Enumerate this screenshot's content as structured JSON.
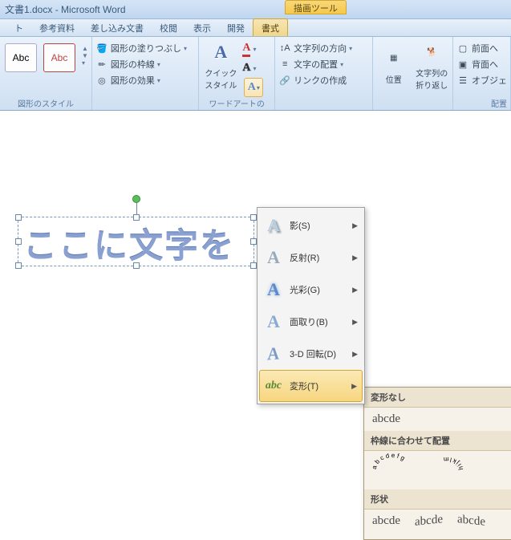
{
  "titlebar": {
    "doc": "文書1.docx",
    "app": "Microsoft Word"
  },
  "contextual_tab": "描画ツール",
  "tabs": [
    "ト",
    "参考資料",
    "差し込み文書",
    "校閲",
    "表示",
    "開発",
    "書式"
  ],
  "ribbon": {
    "shapes_group_label": "図形のスタイル",
    "shape_sample": "Abc",
    "fill": "図形の塗りつぶし",
    "outline": "図形の枠線",
    "effects": "図形の効果",
    "quick_styles": "クイック\nスタイル",
    "wordart_group_label": "ワードアートの",
    "text_dir": "文字列の方向",
    "text_align": "文字の配置",
    "link": "リンクの作成",
    "position": "位置",
    "wrap": "文字列の\n折り返し",
    "front": "前面へ",
    "back": "背面へ",
    "objects": "オブジェ",
    "arrange_label": "配置"
  },
  "wordart_text": "ここに文字を",
  "text_effects_menu": {
    "shadow": "影(S)",
    "reflection": "反射(R)",
    "glow": "光彩(G)",
    "bevel": "面取り(B)",
    "rotation3d": "3-D 回転(D)",
    "transform": "変形(T)"
  },
  "transform_submenu": {
    "none_hdr": "変形なし",
    "none_sample": "abcde",
    "follow_path_hdr": "枠線に合わせて配置",
    "circle_sample_chars": "a b c d e f g",
    "shape_hdr": "形状",
    "shape_sample": "abcde"
  }
}
